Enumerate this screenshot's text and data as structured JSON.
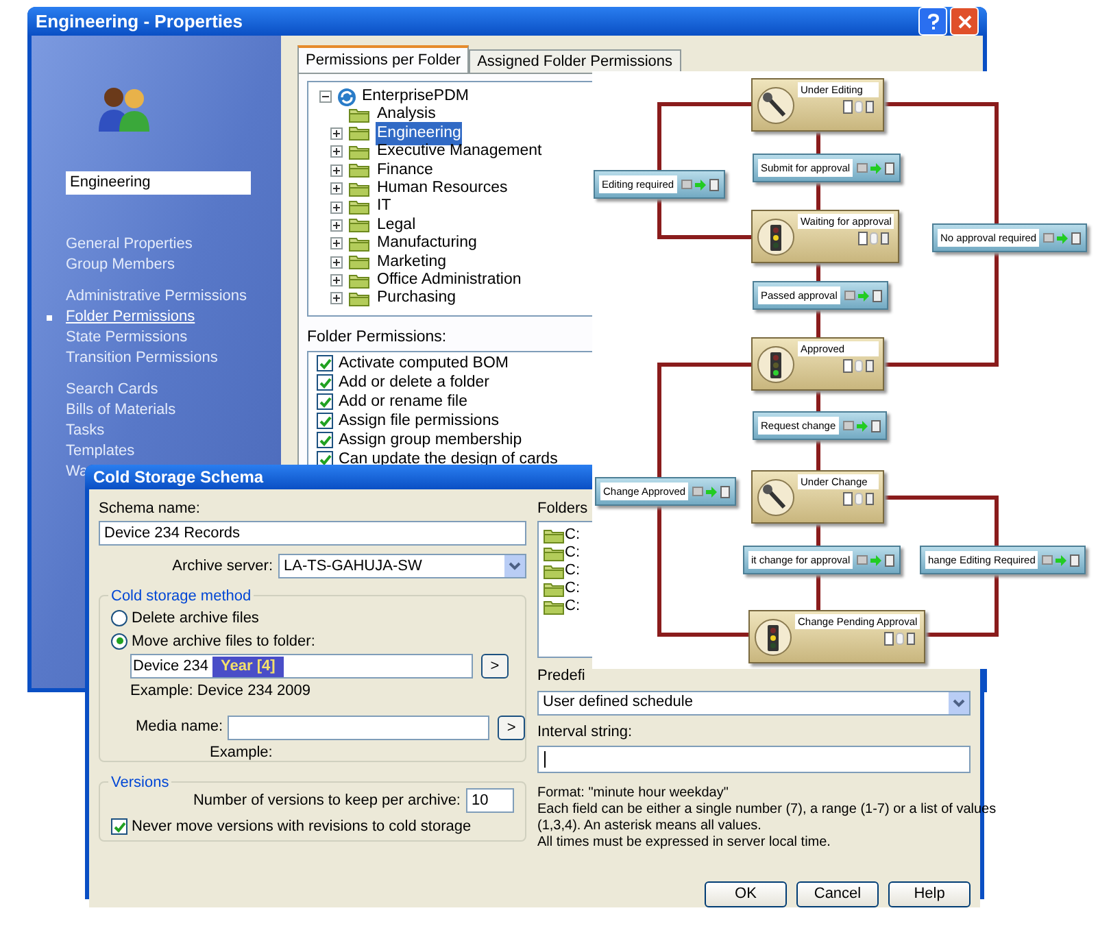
{
  "properties_window": {
    "title": "Engineering - Properties",
    "group_name": "Engineering",
    "nav_groups": [
      {
        "items": [
          {
            "label": "General Properties",
            "selected": false
          },
          {
            "label": "Group Members",
            "selected": false
          }
        ]
      },
      {
        "items": [
          {
            "label": "Administrative Permissions",
            "selected": false
          },
          {
            "label": "Folder Permissions",
            "selected": true
          },
          {
            "label": "State Permissions",
            "selected": false
          },
          {
            "label": "Transition Permissions",
            "selected": false
          }
        ]
      },
      {
        "items": [
          {
            "label": "Search Cards",
            "selected": false
          },
          {
            "label": "Bills of Materials",
            "selected": false
          },
          {
            "label": "Tasks",
            "selected": false
          },
          {
            "label": "Templates",
            "selected": false
          },
          {
            "label": "Wa",
            "selected": false
          }
        ]
      }
    ],
    "tabs": [
      {
        "label": "Permissions per Folder",
        "selected": true
      },
      {
        "label": "Assigned Folder Permissions",
        "selected": false
      }
    ],
    "tree": {
      "label": "EnterprisePDM",
      "expanded": true,
      "children": [
        {
          "label": "Analysis",
          "has_children": false,
          "selected": false
        },
        {
          "label": "Engineering",
          "has_children": true,
          "selected": true
        },
        {
          "label": "Executive Management",
          "has_children": true,
          "selected": false
        },
        {
          "label": "Finance",
          "has_children": true,
          "selected": false
        },
        {
          "label": "Human Resources",
          "has_children": true,
          "selected": false
        },
        {
          "label": "IT",
          "has_children": true,
          "selected": false
        },
        {
          "label": "Legal",
          "has_children": true,
          "selected": false
        },
        {
          "label": "Manufacturing",
          "has_children": true,
          "selected": false
        },
        {
          "label": "Marketing",
          "has_children": true,
          "selected": false
        },
        {
          "label": "Office Administration",
          "has_children": true,
          "selected": false
        },
        {
          "label": "Purchasing",
          "has_children": true,
          "selected": false
        }
      ]
    },
    "permissions_label": "Folder Permissions:",
    "permissions": [
      {
        "label": "Activate computed BOM",
        "checked": true
      },
      {
        "label": "Add or delete a folder",
        "checked": true
      },
      {
        "label": "Add or rename file",
        "checked": true
      },
      {
        "label": "Assign file permissions",
        "checked": true
      },
      {
        "label": "Assign group membership",
        "checked": true
      },
      {
        "label": "Can update the design of cards",
        "checked": true
      }
    ]
  },
  "cold_storage_dialog": {
    "title": "Cold Storage Schema",
    "schema_name_label": "Schema name:",
    "schema_name": "Device 234 Records",
    "archive_server_label": "Archive server:",
    "archive_server": "LA-TS-GAHUJA-SW",
    "method_group": "Cold storage method",
    "methods": [
      {
        "label": "Delete archive files",
        "selected": false
      },
      {
        "label": "Move archive files to folder:",
        "selected": true
      }
    ],
    "folder_text": "Device 234",
    "folder_token": "Year [4]",
    "insert_button": ">",
    "example": "Example: Device 234 2009",
    "media_label": "Media name:",
    "media_insert_button": ">",
    "media_example": "Example:",
    "versions_group": "Versions",
    "versions_label": "Number of versions to keep per archive:",
    "versions_value": "10",
    "never_move": {
      "label": "Never move versions with revisions to cold storage",
      "checked": true
    },
    "folders_label": "Folders",
    "folders": [
      "C:",
      "C:",
      "C:",
      "C:",
      "C:"
    ],
    "predefined_label": "Predefi",
    "schedule": "User defined schedule",
    "interval_label": "Interval string:",
    "format_lines": [
      "Format: \"minute hour weekday\"",
      "Each field can be either a single number (7), a range (1-7) or a list of values",
      "(1,3,4). An asterisk means all values.",
      "All times must be expressed in server local time."
    ],
    "buttons": [
      "OK",
      "Cancel",
      "Help"
    ]
  },
  "workflow": {
    "states": [
      {
        "label": "Under Editing",
        "kind": "edit"
      },
      {
        "label": "Waiting for approval",
        "kind": "waiting"
      },
      {
        "label": "Approved",
        "kind": "approved"
      },
      {
        "label": "Under Change",
        "kind": "edit"
      },
      {
        "label": "Change Pending Approval",
        "kind": "waiting"
      }
    ],
    "transitions": [
      {
        "label": "Submit for approval"
      },
      {
        "label": "Editing required"
      },
      {
        "label": "No approval required"
      },
      {
        "label": "Passed approval"
      },
      {
        "label": "Request change"
      },
      {
        "label": "Change Approved"
      },
      {
        "label": "it change for approval"
      },
      {
        "label": "hange Editing Required"
      }
    ]
  }
}
